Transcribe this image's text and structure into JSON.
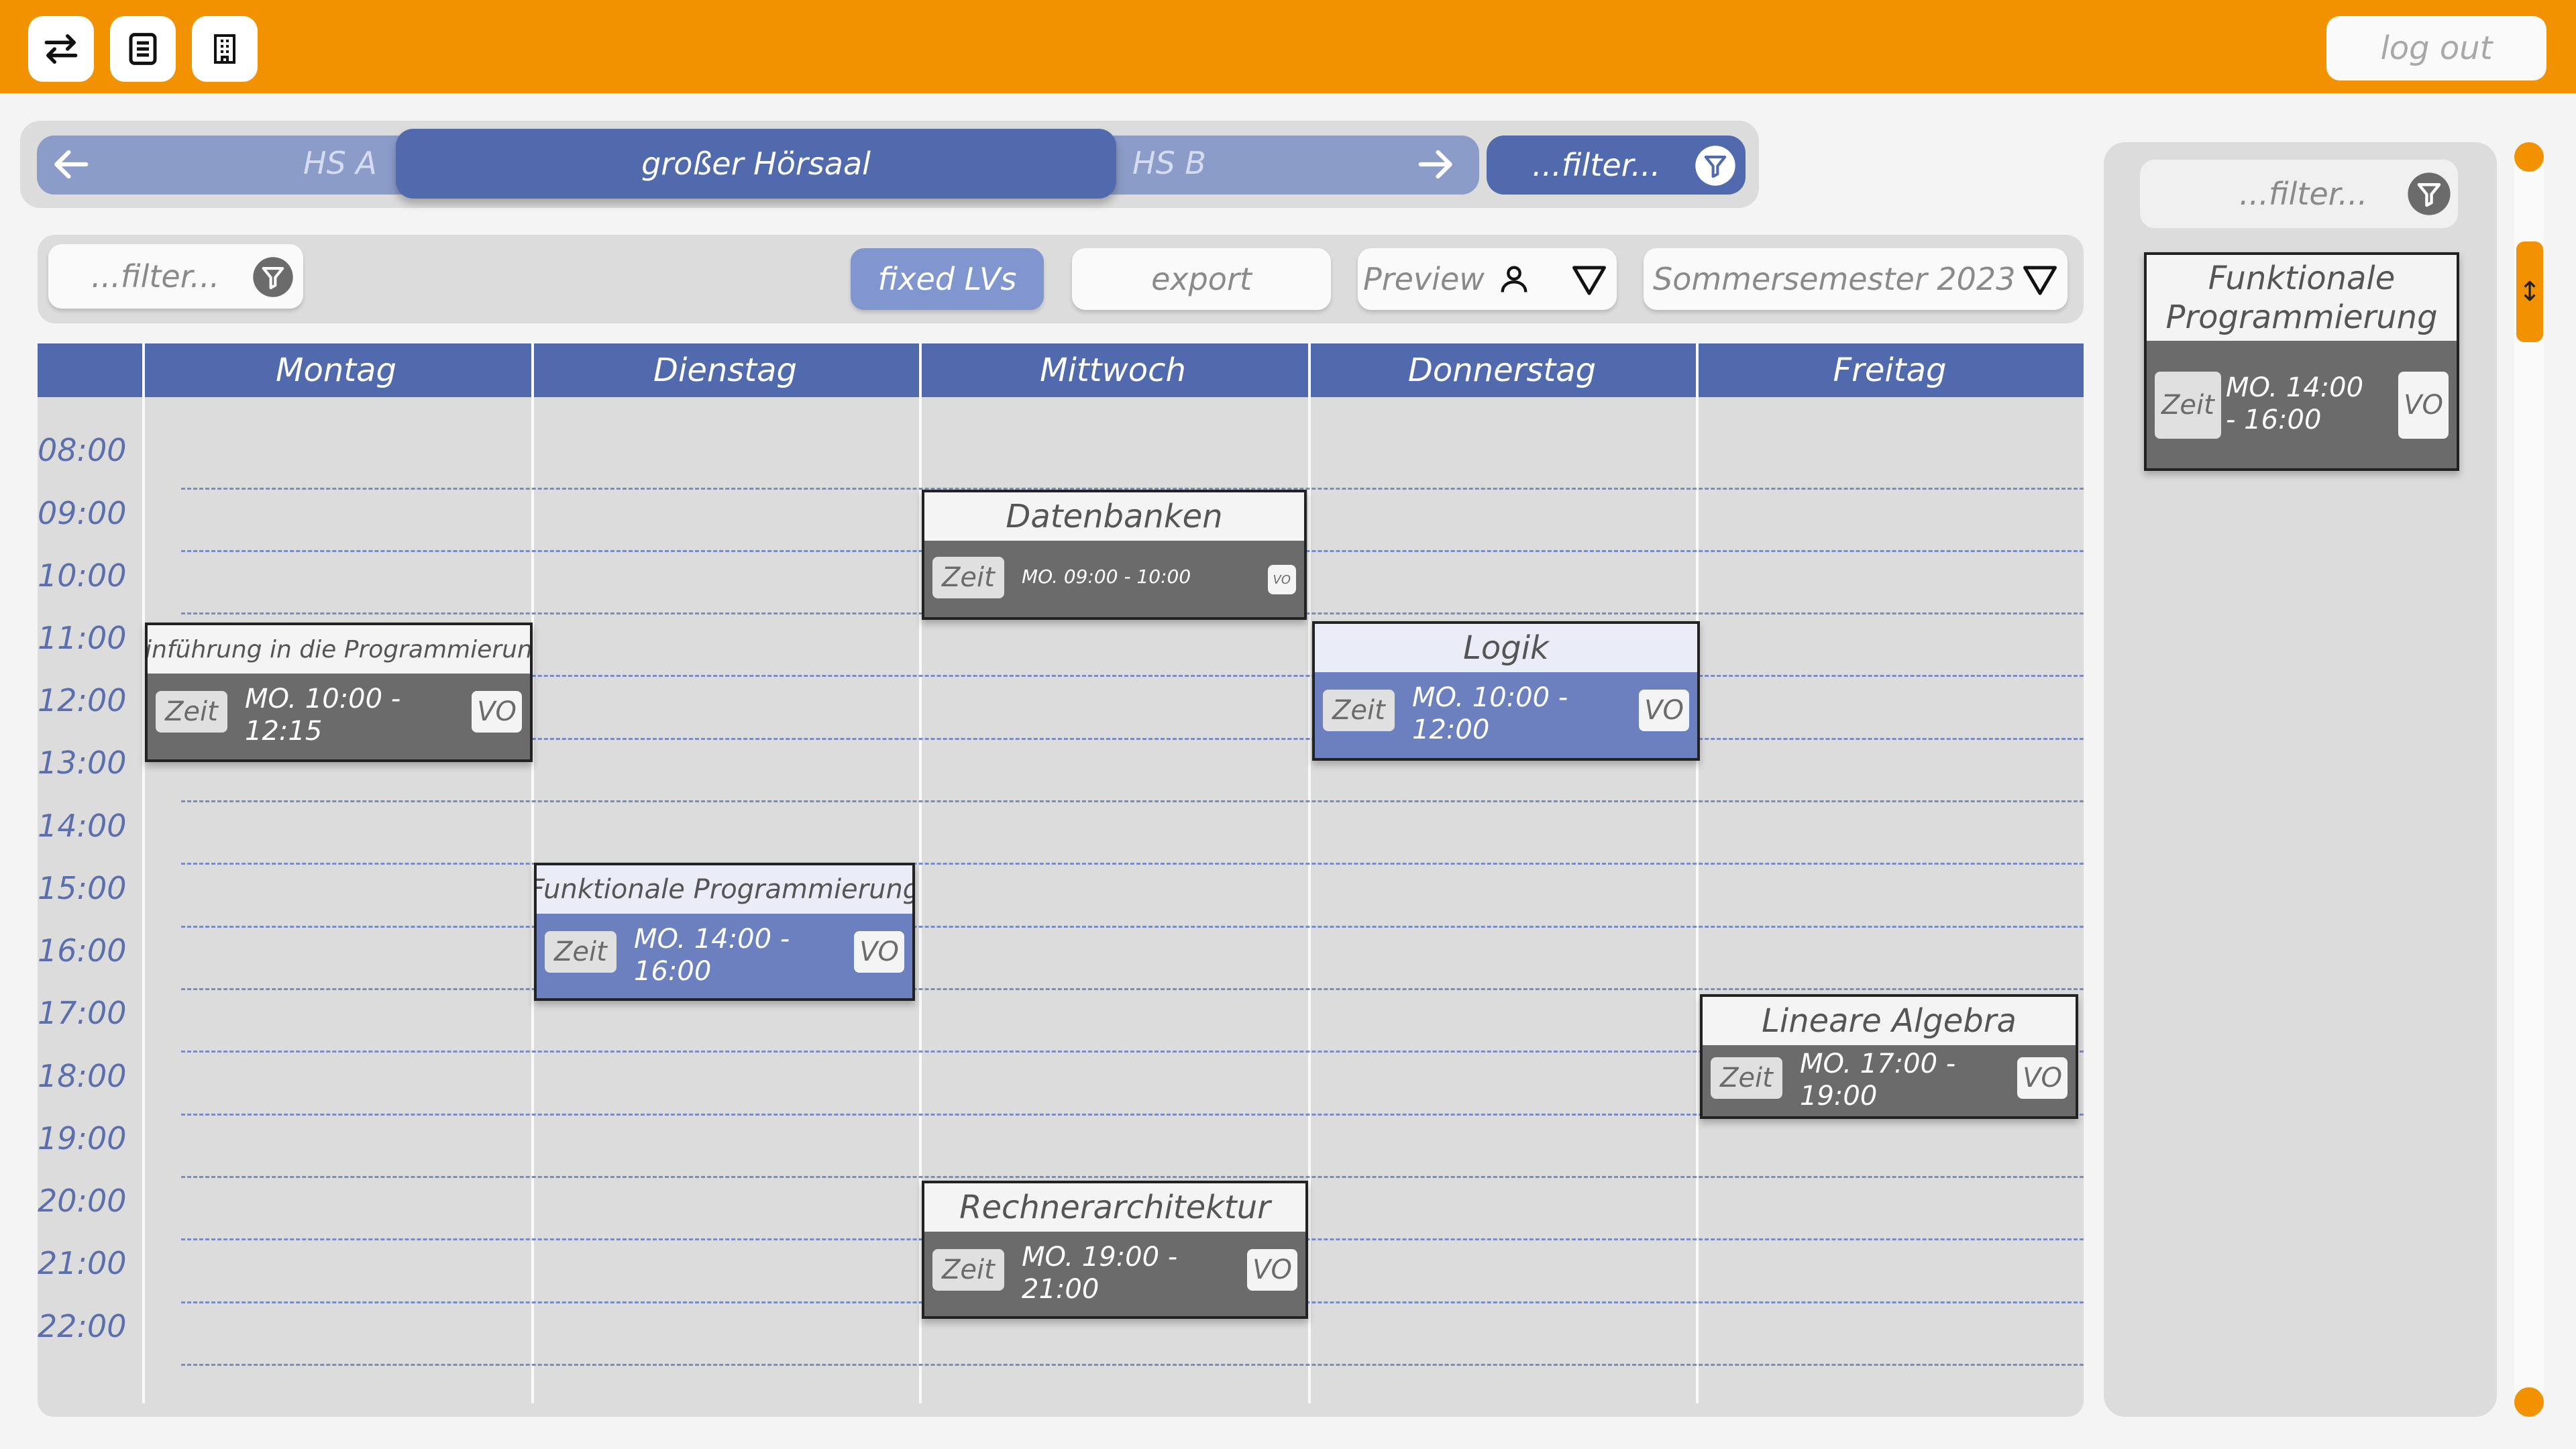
{
  "header": {
    "swap_icon": "swap-arrows-icon",
    "list_icon": "document-list-icon",
    "building_icon": "building-icon",
    "logout_label": "log out"
  },
  "rooms": {
    "prev": "HS A",
    "current": "großer Hörsaal",
    "next": "HS B",
    "filter_placeholder": "...filter..."
  },
  "toolbar": {
    "filter_placeholder": "...filter...",
    "fixed_label": "fixed LVs",
    "export_label": "export",
    "preview_label": "Preview",
    "semester_label": "Sommersemester 2023"
  },
  "calendar": {
    "days": [
      "Montag",
      "Dienstag",
      "Mittwoch",
      "Donnerstag",
      "Freitag"
    ],
    "times": [
      "08:00",
      "09:00",
      "10:00",
      "11:00",
      "12:00",
      "13:00",
      "14:00",
      "15:00",
      "16:00",
      "17:00",
      "18:00",
      "19:00",
      "20:00",
      "21:00",
      "22:00"
    ],
    "events": [
      {
        "title": "Einführung in die Programmierung",
        "zeit": "Zeit",
        "time": "MO. 10:00 - 12:15",
        "type": "VO",
        "style": "gray"
      },
      {
        "title": "Funktionale Programmierung",
        "zeit": "Zeit",
        "time": "MO. 14:00 - 16:00",
        "type": "VO",
        "style": "blue"
      },
      {
        "title": "Datenbanken",
        "zeit": "Zeit",
        "time": "MO. 09:00 - 10:00",
        "type": "VO",
        "style": "gray"
      },
      {
        "title": "Rechnerarchitektur",
        "zeit": "Zeit",
        "time": "MO. 19:00 - 21:00",
        "type": "VO",
        "style": "gray"
      },
      {
        "title": "Logik",
        "zeit": "Zeit",
        "time": "MO. 10:00 - 12:00",
        "type": "VO",
        "style": "blue"
      },
      {
        "title": "Lineare Algebra",
        "zeit": "Zeit",
        "time": "MO. 17:00 - 19:00",
        "type": "VO",
        "style": "gray"
      }
    ]
  },
  "side": {
    "filter_placeholder": "...filter...",
    "card": {
      "title": "Funktionale Programmierung",
      "zeit": "Zeit",
      "time": "MO. 14:00 - 16:00",
      "type": "VO"
    }
  },
  "colors": {
    "accent": "#f39200",
    "primary": "#5169ad",
    "event_gray": "#6b6b6b",
    "event_blue": "#6c80c0"
  }
}
